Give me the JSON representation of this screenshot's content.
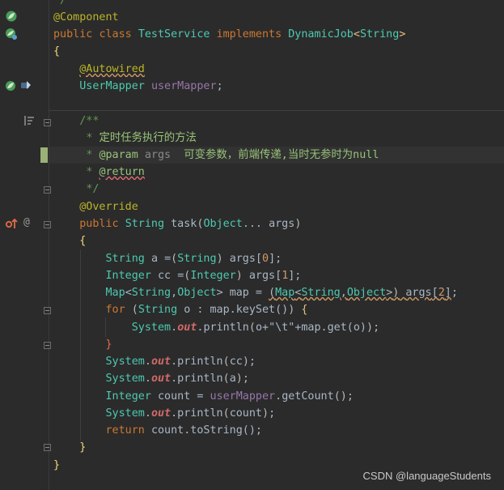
{
  "code": {
    "line_comment_end": "*/",
    "annotation_component": "@Component",
    "class_decl": {
      "public": "public",
      "class": "class",
      "name": "TestService",
      "implements": "implements",
      "iface": "DynamicJob",
      "lt": "<",
      "generic": "String",
      "gt": ">"
    },
    "open_brace": "{",
    "autowired": "@Autowired",
    "field_type": "UserMapper",
    "field_name": "userMapper",
    "semicolon": ";",
    "doc_start": "/**",
    "doc_line1_star": "*",
    "doc_line1_text": "定时任务执行的方法",
    "doc_line2_star": "*",
    "doc_param_tag": "@param",
    "doc_param_name": "args",
    "doc_param_desc": "可变参数，前端传递,当时无参时为null",
    "doc_line3_star": "*",
    "doc_return_tag": "@return",
    "doc_end": "*/",
    "override": "@Override",
    "method_sig": {
      "public": "public",
      "ret": "String",
      "name": "task",
      "param_type": "Object",
      "ellipsis": "...",
      "param": "args"
    },
    "method_open": "{",
    "stmt1": {
      "type": "String",
      "name": "a",
      "eq": "=",
      "cast": "String",
      "arr": "args",
      "idx": "0"
    },
    "stmt2": {
      "type": "Integer",
      "name": "cc",
      "eq": "=",
      "cast": "Integer",
      "arr": "args",
      "idx": "1"
    },
    "stmt3": {
      "type": "Map",
      "k": "String",
      "v": "Object",
      "name": "map",
      "cast": "Map",
      "arr": "args",
      "idx": "2"
    },
    "for_kw": "for",
    "for_type": "String",
    "for_var": "o",
    "for_src": "map.keySet()",
    "print1": {
      "sys": "System",
      "out": "out",
      "call": "println",
      "args_pre": "o+",
      "str": "\"\\t\"",
      "args_post": "+map.get(o)"
    },
    "close_inner": "}",
    "print_cc": "cc",
    "print_a": "a",
    "count_stmt": {
      "type": "Integer",
      "name": "count",
      "recv": "userMapper",
      "call": "getCount"
    },
    "print_count": "count",
    "return_kw": "return",
    "return_expr": "count.toString();",
    "method_close": "}",
    "class_close": "}"
  },
  "gutter_icons": [
    "spring-bean-icon",
    "spring-bean-icon",
    "autowire-icon",
    "autowire-target-icon",
    "doc-render-icon",
    "override-up-icon",
    "at-annotation-icon"
  ],
  "watermark": "CSDN @languageStudents"
}
